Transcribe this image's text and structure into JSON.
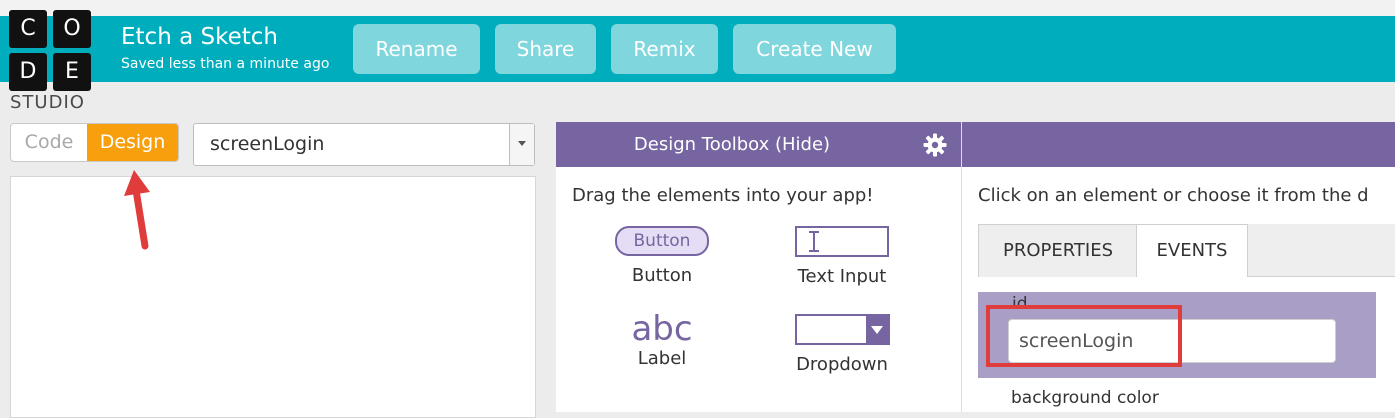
{
  "logo": {
    "letters": [
      "C",
      "O",
      "D",
      "E"
    ],
    "studio": "STUDIO"
  },
  "project": {
    "title": "Etch a Sketch",
    "subtitle": "Saved less than a minute ago"
  },
  "header_buttons": {
    "rename": "Rename",
    "share": "Share",
    "remix": "Remix",
    "create_new": "Create New"
  },
  "mode_toggle": {
    "code": "Code",
    "design": "Design",
    "active": "Design"
  },
  "screen_select": {
    "value": "screenLogin"
  },
  "toolbox": {
    "title": "Design Toolbox (Hide)",
    "hint": "Drag the elements into your app!",
    "items": [
      {
        "icon_text": "Button",
        "label": "Button"
      },
      {
        "label": "Text Input"
      },
      {
        "icon_text": "abc",
        "label": "Label"
      },
      {
        "label": "Dropdown"
      }
    ]
  },
  "properties": {
    "hint": "Click on an element or choose it from the d",
    "tabs": [
      "PROPERTIES",
      "EVENTS"
    ],
    "id_label": "id",
    "id_value": "screenLogin",
    "next_label": "background color"
  },
  "colors": {
    "header": "#00adbc",
    "toolbox": "#7665a0",
    "design_active": "#f89f0e",
    "highlight": "#e03c3c"
  }
}
